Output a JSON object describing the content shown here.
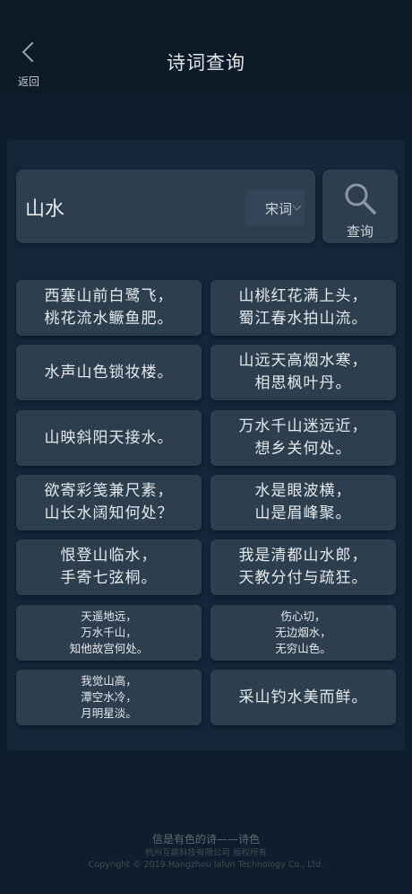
{
  "header": {
    "back_label": "返回",
    "title": "诗词查询"
  },
  "search": {
    "value": "山水",
    "type_label": "宋词",
    "query_label": "查询"
  },
  "results": [
    "西塞山前白鹭飞，\n桃花流水鳜鱼肥。",
    "山桃红花满上头，\n蜀江春水拍山流。",
    "水声山色锁妆楼。",
    "山远天高烟水寒，\n相思枫叶丹。",
    "山映斜阳天接水。",
    "万水千山迷远近，\n想乡关何处。",
    "欲寄彩笺兼尺素，\n山长水阔知何处？",
    "水是眼波横，\n山是眉峰聚。",
    "恨登山临水，\n手寄七弦桐。",
    "我是清都山水郎，\n天教分付与疏狂。",
    "天遥地远，\n万水千山，\n知他故宫何处。",
    "伤心切，\n无边烟水，\n无穷山色。",
    "我觉山高，\n潭空水冷，\n月明星淡。",
    "采山钓水美而鲜。"
  ],
  "footer": {
    "slogan": "信是有色的诗——诗色",
    "company": "杭州互趣科技有限公司 版权所有",
    "copyright": "Copyright © 2019 Hangzhou lafun Technology Co., Ltd."
  },
  "colors": {
    "background": "#0f1e2c",
    "card": "#2d3e4f",
    "text": "#e6e9ec"
  }
}
